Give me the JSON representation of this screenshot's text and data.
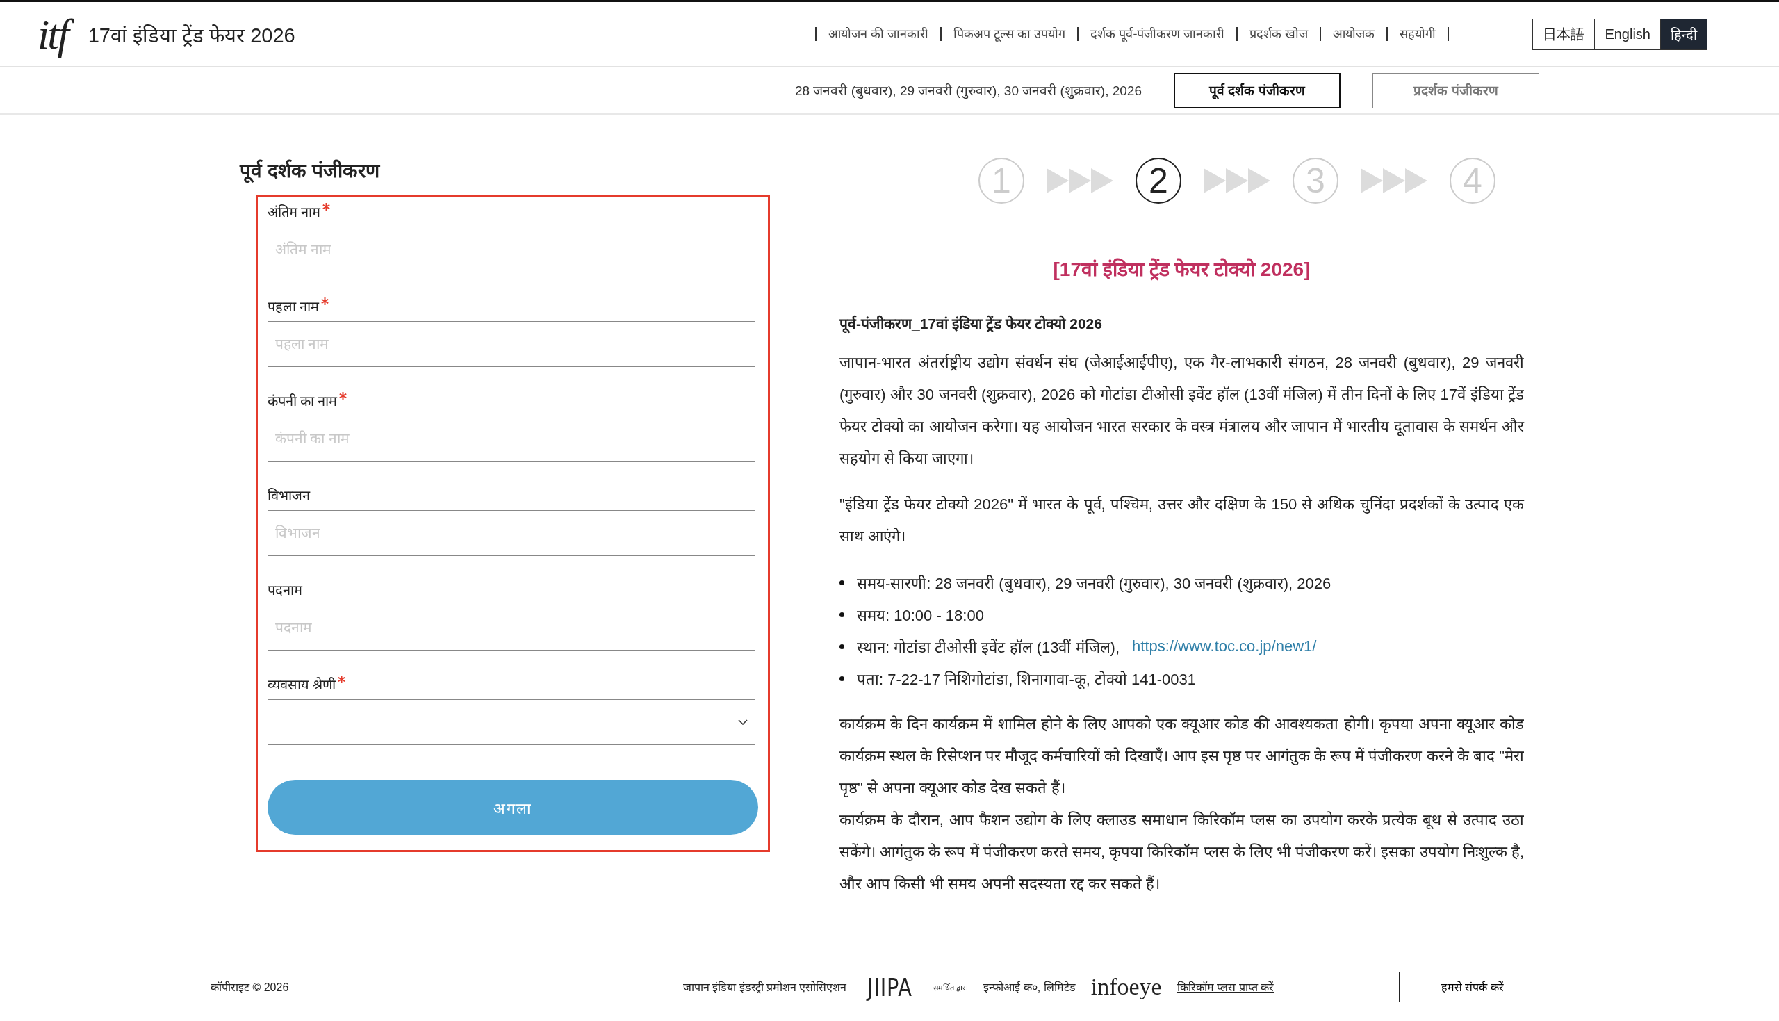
{
  "header": {
    "logo": "itf",
    "title": "17वां इंडिया ट्रेंड फेयर 2026",
    "nav": [
      "आयोजन की जानकारी",
      "पिकअप टूल्स का उपयोग",
      "दर्शक पूर्व-पंजीकरण जानकारी",
      "प्रदर्शक खोज",
      "आयोजक",
      "सहयोगी"
    ],
    "languages": [
      {
        "label": "日本語",
        "selected": false
      },
      {
        "label": "English",
        "selected": false
      },
      {
        "label": "हिन्दी",
        "selected": true
      }
    ]
  },
  "subheader": {
    "dates": "28 जनवरी (बुधवार), 29 जनवरी (गुरुवार), 30 जनवरी (शुक्रवार), 2026",
    "buttons": [
      {
        "label": "पूर्व दर्शक पंजीकरण",
        "selected": true
      },
      {
        "label": "प्रदर्शक पंजीकरण",
        "selected": false
      }
    ]
  },
  "form": {
    "title": "पूर्व दर्शक पंजीकरण",
    "fields": [
      {
        "kind": "text",
        "label": "अंतिम नाम",
        "required": true,
        "placeholder": "अंतिम नाम"
      },
      {
        "kind": "text",
        "label": "पहला नाम",
        "required": true,
        "placeholder": "पहला नाम"
      },
      {
        "kind": "text",
        "label": "कंपनी का नाम",
        "required": true,
        "placeholder": "कंपनी का नाम"
      },
      {
        "kind": "text",
        "label": "विभाजन",
        "required": false,
        "placeholder": "विभाजन"
      },
      {
        "kind": "text",
        "label": "पदनाम",
        "required": false,
        "placeholder": "पदनाम"
      },
      {
        "kind": "select",
        "label": "व्यवसाय श्रेणी",
        "required": true
      }
    ],
    "submit": "अगला"
  },
  "steps": [
    {
      "number": "1",
      "selected": false
    },
    {
      "number": "2",
      "selected": true
    },
    {
      "number": "3",
      "selected": false
    },
    {
      "number": "4",
      "selected": false
    }
  ],
  "info": {
    "heading": "[17वां इंडिया ट्रेंड फेयर टोक्यो 2026]",
    "subheading": "पूर्व-पंजीकरण_17वां इंडिया ट्रेंड फेयर टोक्यो 2026",
    "paragraphs": [
      "जापान-भारत अंतर्राष्ट्रीय उद्योग संवर्धन संघ (जेआईआईपीए), एक गैर-लाभकारी संगठन, 28 जनवरी (बुधवार), 29 जनवरी (गुरुवार) और 30 जनवरी (शुक्रवार), 2026 को गोटांडा टीओसी इवेंट हॉल (13वीं मंजिल) में तीन दिनों के लिए 17वें इंडिया ट्रेंड फेयर टोक्यो का आयोजन करेगा। यह आयोजन भारत सरकार के वस्त्र मंत्रालय और जापान में भारतीय दूतावास के समर्थन और सहयोग से किया जाएगा।",
      "\"इंडिया ट्रेंड फेयर टोक्यो 2026\" में भारत के पूर्व, पश्चिम, उत्तर और दक्षिण के 150 से अधिक चुनिंदा प्रदर्शकों के उत्पाद एक साथ आएंगे।"
    ],
    "bullets": [
      {
        "text": "समय-सारणी: 28 जनवरी (बुधवार), 29 जनवरी (गुरुवार), 30 जनवरी (शुक्रवार), 2026"
      },
      {
        "text": "समय: 10:00 - 18:00"
      },
      {
        "text": "स्थान: गोटांडा टीओसी इवेंट हॉल (13वीं मंजिल),",
        "link": "https://www.toc.co.jp/new1/"
      },
      {
        "text": "पता: 7-22-17 निशिगोटांडा, शिनागावा-कू, टोक्यो 141-0031"
      }
    ],
    "closing": [
      "कार्यक्रम के दिन कार्यक्रम में शामिल होने के लिए आपको एक क्यूआर कोड की आवश्यकता होगी। कृपया अपना क्यूआर कोड कार्यक्रम स्थल के रिसेप्शन पर मौजूद कर्मचारियों को दिखाएँ। आप इस पृष्ठ पर आगंतुक के रूप में पंजीकरण करने के बाद \"मेरा पृष्ठ\" से अपना क्यूआर कोड देख सकते हैं।",
      "कार्यक्रम के दौरान, आप फैशन उद्योग के लिए क्लाउड समाधान किरिकॉम प्लस का उपयोग करके प्रत्येक बूथ से उत्पाद उठा सकेंगे। आगंतुक के रूप में पंजीकरण करते समय, कृपया किरिकॉम प्लस के लिए भी पंजीकरण करें। इसका उपयोग निःशुल्क है, और आप किसी भी समय अपनी सदस्यता रद्द कर सकते हैं।"
    ]
  },
  "footer": {
    "copyright": "कॉपीराइट © 2026",
    "organizer": "जापान इंडिया इंडस्ट्री प्रमोशन एसोसिएशन",
    "organizer_logo": "JIIPA",
    "supported_by": "समर्थित द्वारा",
    "supporter": "इन्फोआई क०, लिमिटेड",
    "supporter_logo": "infoeye",
    "link": "किरिकॉम प्लस प्राप्त करें",
    "contact": "हमसे संपर्क करें"
  }
}
